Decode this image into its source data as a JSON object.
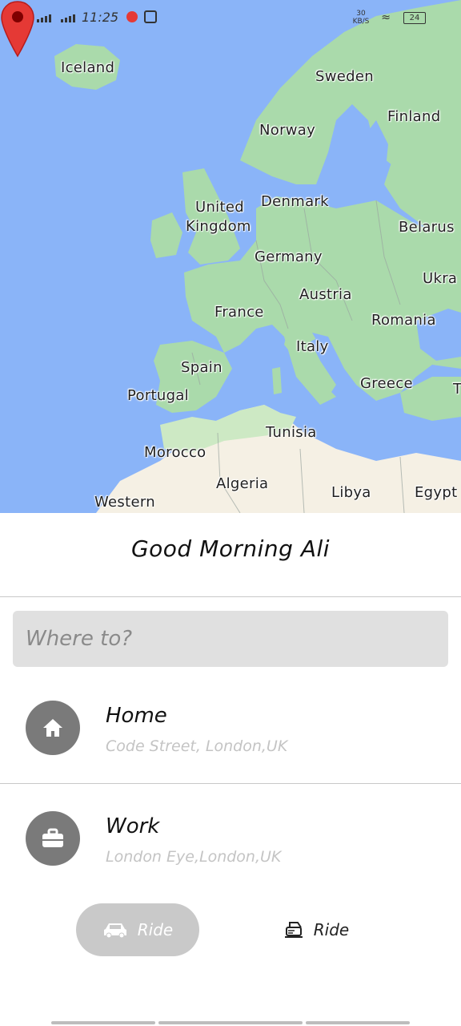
{
  "status_bar": {
    "time": "11:25",
    "network_speed": "30 KB/S",
    "battery": "24"
  },
  "map": {
    "labels": {
      "iceland": "Iceland",
      "sweden": "Sweden",
      "finland": "Finland",
      "norway": "Norway",
      "denmark": "Denmark",
      "united_kingdom_a": "United",
      "united_kingdom_b": "Kingdom",
      "belarus": "Belarus",
      "germany": "Germany",
      "ukraine": "Ukra",
      "austria": "Austria",
      "france": "France",
      "romania": "Romania",
      "italy": "Italy",
      "spain": "Spain",
      "portugal": "Portugal",
      "greece": "Greece",
      "tunisia": "Tunisia",
      "morocco": "Morocco",
      "algeria": "Algeria",
      "libya": "Libya",
      "egypt": "Egypt",
      "western": "Western",
      "turkey_t": "T"
    },
    "colors": {
      "water": "#8ab4f8",
      "land": "#aadaab",
      "desert": "#f5f0e4",
      "pin": "#e53935"
    }
  },
  "greeting": "Good Morning Ali",
  "search": {
    "placeholder": "Where to?"
  },
  "saved_places": [
    {
      "title": "Home",
      "address": "Code Street, London,UK",
      "icon": "home-icon"
    },
    {
      "title": "Work",
      "address": "London Eye,London,UK",
      "icon": "briefcase-icon"
    }
  ],
  "ride_options": [
    {
      "label": "Ride",
      "icon": "car-icon",
      "selected": true
    },
    {
      "label": "Ride",
      "icon": "motorbike-icon",
      "selected": false
    }
  ]
}
